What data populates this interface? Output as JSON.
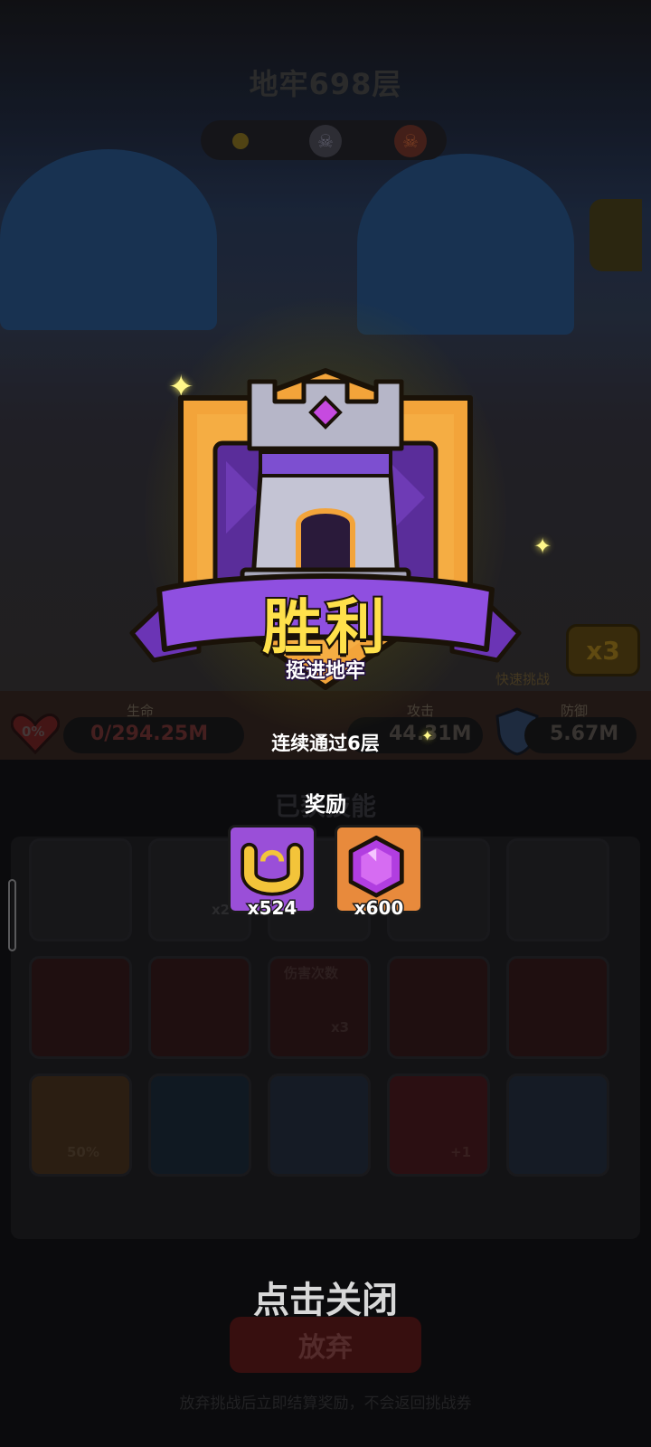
{
  "header": {
    "floor_title": "地牢698层"
  },
  "background": {
    "side_label": "快速挑战",
    "speed_button": "x3",
    "stats": {
      "hp_label": "生命",
      "hp_value": "0/294.25M",
      "hp_percent": "0%",
      "atk_label": "攻击",
      "atk_value": "44.31M",
      "def_label": "防御",
      "def_value": "5.67M"
    },
    "skills_heading": "已获技能",
    "skill_badges": [
      "x2",
      "伤害次数",
      "x3",
      "50%",
      "+1"
    ],
    "abandon_button": "放弃",
    "abandon_note": "放弃挑战后立即结算奖励，不会返回挑战券"
  },
  "victory": {
    "title": "胜利",
    "subtitle": "挺进地牢",
    "streak": "连续通过6层",
    "reward_heading": "奖励",
    "rewards": [
      {
        "icon": "horseshoe-icon",
        "quantity": "x524",
        "bg": "#9a4fd8"
      },
      {
        "icon": "purple-gem-icon",
        "quantity": "x600",
        "bg": "#e88a3c"
      }
    ],
    "close_hint": "点击关闭"
  },
  "colors": {
    "accent_gold": "#ffe14b",
    "ribbon_purple": "#8f4fe0",
    "badge_orange": "#f3a43a"
  }
}
